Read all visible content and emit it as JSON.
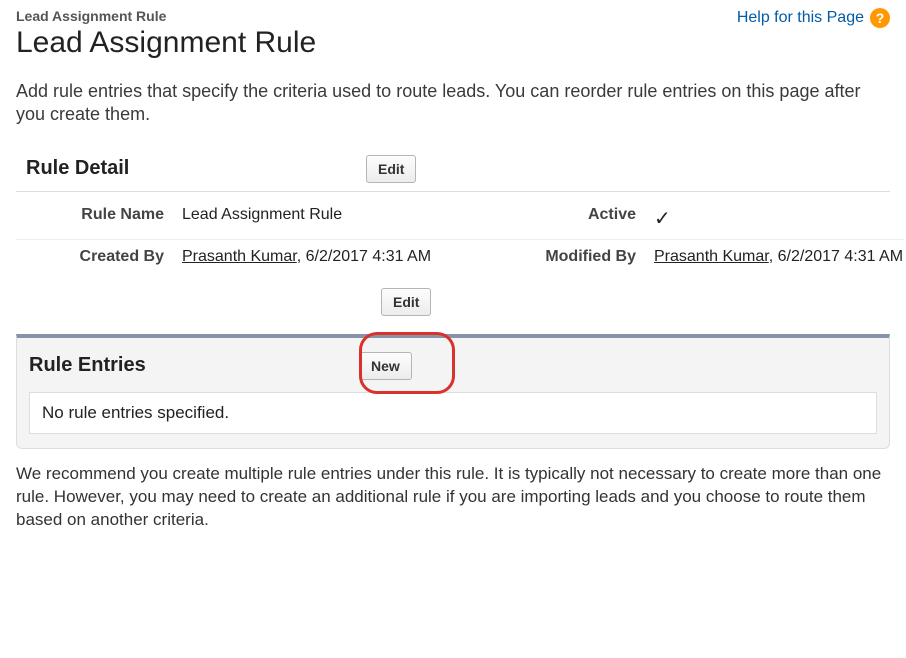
{
  "breadcrumb": "Lead Assignment Rule",
  "page_title": "Lead Assignment Rule",
  "help_link": "Help for this Page",
  "intro": "Add rule entries that specify the criteria used to route leads. You can reorder rule entries on this page after you create them.",
  "detail_section": {
    "title": "Rule Detail",
    "edit_label": "Edit",
    "rows": {
      "rule_name": {
        "label": "Rule Name",
        "value": "Lead Assignment Rule"
      },
      "active": {
        "label": "Active",
        "checked": true
      },
      "created_by": {
        "label": "Created By",
        "user": "Prasanth Kumar",
        "at": ", 6/2/2017 4:31 AM"
      },
      "modified_by": {
        "label": "Modified By",
        "user": "Prasanth Kumar",
        "at": ", 6/2/2017 4:31 AM"
      }
    }
  },
  "entries_section": {
    "title": "Rule Entries",
    "new_label": "New",
    "empty_message": "No rule entries specified."
  },
  "footer_note": "We recommend you create multiple rule entries under this rule. It is typically not necessary to create more than one rule. However, you may need to create an additional rule if you are importing leads and you choose to route them based on another criteria."
}
